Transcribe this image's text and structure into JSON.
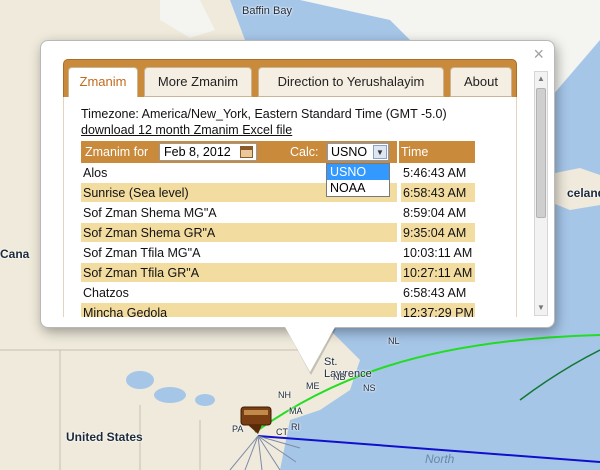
{
  "map": {
    "labels": {
      "baffin_bay": "Baffin Bay",
      "iceland": "celand",
      "canada": "Cana",
      "st_lawrence": "St. Lawrence",
      "united_states": "United States",
      "north_atlantic": "North",
      "pa": "PA",
      "ri": "RI",
      "ct": "CT",
      "ma": "MA",
      "nh": "NH",
      "me": "ME",
      "nb": "NB",
      "ns": "NS",
      "nl": "NL"
    },
    "colors": {
      "water": "#a6c6e8",
      "land": "#f0ede0",
      "green_route": "#22dd22",
      "blue_route": "#1010cc"
    }
  },
  "popup": {
    "close_label": "×",
    "tabs": [
      {
        "label": "Zmanim",
        "active": true
      },
      {
        "label": "More Zmanim",
        "active": false
      },
      {
        "label": "Direction to Yerushalayim",
        "active": false
      },
      {
        "label": "About",
        "active": false
      }
    ],
    "timezone_text": "Timezone: America/New_York, Eastern Standard Time (GMT -5.0)",
    "download_link": "download 12 month Zmanim Excel file",
    "header": {
      "zmanim_for_label": "Zmanim for",
      "date_value": "Feb 8, 2012",
      "calc_label": "Calc:",
      "calc_value": "USNO",
      "time_label": "Time"
    },
    "calc_options": [
      "USNO",
      "NOAA"
    ],
    "rows": [
      {
        "name": "Alos",
        "time": "5:46:43 AM"
      },
      {
        "name": "Sunrise (Sea level)",
        "time": "6:58:43 AM"
      },
      {
        "name": "Sof Zman Shema MG\"A",
        "time": "8:59:04 AM"
      },
      {
        "name": "Sof Zman Shema GR\"A",
        "time": "9:35:04 AM"
      },
      {
        "name": "Sof Zman Tfila MG\"A",
        "time": "10:03:11 AM"
      },
      {
        "name": "Sof Zman Tfila GR\"A",
        "time": "10:27:11 AM"
      },
      {
        "name": "Chatzos",
        "time": "6:58:43 AM"
      },
      {
        "name": "Mincha Gedola",
        "time": "12:37:29 PM"
      }
    ],
    "colors": {
      "accent": "#c98a3b",
      "alt_row": "#f3dca0",
      "active_tab_text": "#c26b1b",
      "selected_option": "#3399ff"
    }
  }
}
